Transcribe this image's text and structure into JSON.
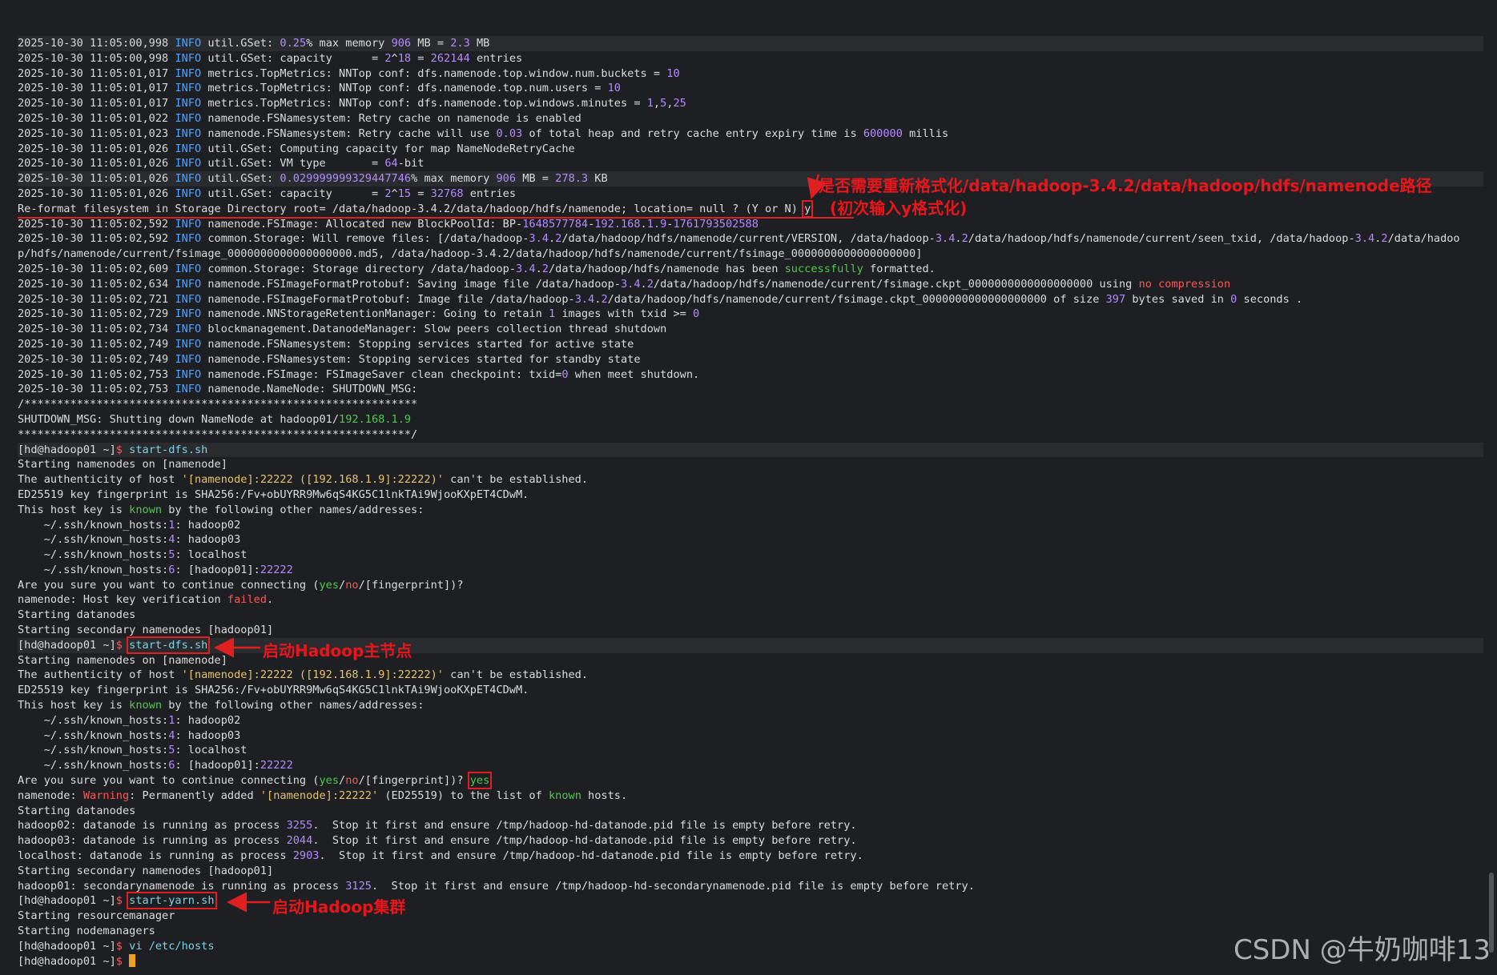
{
  "terminal": {
    "lines": [
      "2025-10-30 11:05:00,998 INFO util.GSet: 0.25% max memory 906 MB = 2.3 MB",
      "2025-10-30 11:05:00,998 INFO util.GSet: capacity      = 2^18 = 262144 entries",
      "2025-10-30 11:05:01,017 INFO metrics.TopMetrics: NNTop conf: dfs.namenode.top.window.num.buckets = 10",
      "2025-10-30 11:05:01,017 INFO metrics.TopMetrics: NNTop conf: dfs.namenode.top.num.users = 10",
      "2025-10-30 11:05:01,017 INFO metrics.TopMetrics: NNTop conf: dfs.namenode.top.windows.minutes = 1,5,25",
      "2025-10-30 11:05:01,022 INFO namenode.FSNamesystem: Retry cache on namenode is enabled",
      "2025-10-30 11:05:01,023 INFO namenode.FSNamesystem: Retry cache will use 0.03 of total heap and retry cache entry expiry time is 600000 millis",
      "2025-10-30 11:05:01,026 INFO util.GSet: Computing capacity for map NameNodeRetryCache",
      "2025-10-30 11:05:01,026 INFO util.GSet: VM type       = 64-bit",
      "2025-10-30 11:05:01,026 INFO util.GSet: 0.029999999329447746% max memory 906 MB = 278.3 KB",
      "2025-10-30 11:05:01,026 INFO util.GSet: capacity      = 2^15 = 32768 entries",
      "Re-format filesystem in Storage Directory root= /data/hadoop-3.4.2/data/hadoop/hdfs/namenode; location= null ? (Y or N) y",
      "2025-10-30 11:05:02,592 INFO namenode.FSImage: Allocated new BlockPoolId: BP-1648577784-192.168.1.9-1761793502588",
      "2025-10-30 11:05:02,592 INFO common.Storage: Will remove files: [/data/hadoop-3.4.2/data/hadoop/hdfs/namenode/current/VERSION, /data/hadoop-3.4.2/data/hadoop/hdfs/namenode/current/seen_txid, /data/hadoop-3.4.2/data/hadoo",
      "p/hdfs/namenode/current/fsimage_0000000000000000000.md5, /data/hadoop-3.4.2/data/hadoop/hdfs/namenode/current/fsimage_0000000000000000000]",
      "2025-10-30 11:05:02,609 INFO common.Storage: Storage directory /data/hadoop-3.4.2/data/hadoop/hdfs/namenode has been successfully formatted.",
      "2025-10-30 11:05:02,634 INFO namenode.FSImageFormatProtobuf: Saving image file /data/hadoop-3.4.2/data/hadoop/hdfs/namenode/current/fsimage.ckpt_0000000000000000000 using no compression",
      "2025-10-30 11:05:02,721 INFO namenode.FSImageFormatProtobuf: Image file /data/hadoop-3.4.2/data/hadoop/hdfs/namenode/current/fsimage.ckpt_0000000000000000000 of size 397 bytes saved in 0 seconds .",
      "2025-10-30 11:05:02,729 INFO namenode.NNStorageRetentionManager: Going to retain 1 images with txid >= 0",
      "2025-10-30 11:05:02,734 INFO blockmanagement.DatanodeManager: Slow peers collection thread shutdown",
      "2025-10-30 11:05:02,749 INFO namenode.FSNamesystem: Stopping services started for active state",
      "2025-10-30 11:05:02,749 INFO namenode.FSNamesystem: Stopping services started for standby state",
      "2025-10-30 11:05:02,753 INFO namenode.FSImage: FSImageSaver clean checkpoint: txid=0 when meet shutdown.",
      "2025-10-30 11:05:02,753 INFO namenode.NameNode: SHUTDOWN_MSG:",
      "/************************************************************",
      "SHUTDOWN_MSG: Shutting down NameNode at hadoop01/192.168.1.9",
      "************************************************************/",
      "[hd@hadoop01 ~]$ start-dfs.sh",
      "Starting namenodes on [namenode]",
      "The authenticity of host '[namenode]:22222 ([192.168.1.9]:22222)' can't be established.",
      "ED25519 key fingerprint is SHA256:/Fv+obUYRR9Mw6qS4KG5C1lnkTAi9WjooKXpET4CDwM.",
      "This host key is known by the following other names/addresses:",
      "    ~/.ssh/known_hosts:1: hadoop02",
      "    ~/.ssh/known_hosts:4: hadoop03",
      "    ~/.ssh/known_hosts:5: localhost",
      "    ~/.ssh/known_hosts:6: [hadoop01]:22222",
      "Are you sure you want to continue connecting (yes/no/[fingerprint])?",
      "namenode: Host key verification failed.",
      "Starting datanodes",
      "Starting secondary namenodes [hadoop01]",
      "[hd@hadoop01 ~]$ start-dfs.sh",
      "Starting namenodes on [namenode]",
      "The authenticity of host '[namenode]:22222 ([192.168.1.9]:22222)' can't be established.",
      "ED25519 key fingerprint is SHA256:/Fv+obUYRR9Mw6qS4KG5C1lnkTAi9WjooKXpET4CDwM.",
      "This host key is known by the following other names/addresses:",
      "    ~/.ssh/known_hosts:1: hadoop02",
      "    ~/.ssh/known_hosts:4: hadoop03",
      "    ~/.ssh/known_hosts:5: localhost",
      "    ~/.ssh/known_hosts:6: [hadoop01]:22222",
      "Are you sure you want to continue connecting (yes/no/[fingerprint])? yes",
      "namenode: Warning: Permanently added '[namenode]:22222' (ED25519) to the list of known hosts.",
      "Starting datanodes",
      "hadoop02: datanode is running as process 3255.  Stop it first and ensure /tmp/hadoop-hd-datanode.pid file is empty before retry.",
      "hadoop03: datanode is running as process 2044.  Stop it first and ensure /tmp/hadoop-hd-datanode.pid file is empty before retry.",
      "localhost: datanode is running as process 2903.  Stop it first and ensure /tmp/hadoop-hd-datanode.pid file is empty before retry.",
      "Starting secondary namenodes [hadoop01]",
      "hadoop01: secondarynamenode is running as process 3125.  Stop it first and ensure /tmp/hadoop-hd-secondarynamenode.pid file is empty before retry.",
      "[hd@hadoop01 ~]$ start-yarn.sh",
      "Starting resourcemanager",
      "Starting nodemanagers",
      "[hd@hadoop01 ~]$ vi /etc/hosts",
      "[hd@hadoop01 ~]$ "
    ]
  },
  "annotations": {
    "reformat_note_1": "是否需要重新格式化/data/hadoop-3.4.2/data/hadoop/hdfs/namenode路径",
    "reformat_note_2": "(初次输入y格式化)",
    "start_dfs_note": "启动Hadoop主节点",
    "start_yarn_note": "启动Hadoop集群"
  },
  "watermark": "CSDN @牛奶咖啡13",
  "colors": {
    "background": "#1e1f22",
    "annotation": "#e8161b",
    "info": "#4ea1ff",
    "number": "#b28cff",
    "string": "#e6c36b",
    "success": "#4ec94e",
    "error": "#ff5555"
  }
}
